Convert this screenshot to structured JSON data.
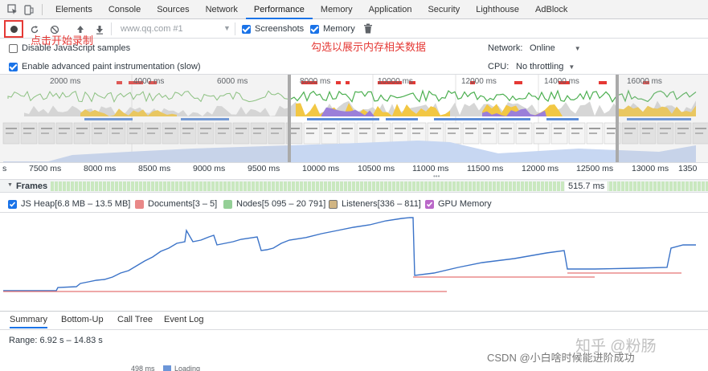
{
  "tabs": [
    "Elements",
    "Console",
    "Sources",
    "Network",
    "Performance",
    "Memory",
    "Application",
    "Security",
    "Lighthouse",
    "AdBlock"
  ],
  "active_tab": "Performance",
  "toolbar": {
    "url_placeholder": "www.qq.com #1",
    "screenshots_label": "Screenshots",
    "memory_label": "Memory",
    "annotation_record": "点击开始录制",
    "annotation_memory": "勾选以展示内存相关数据"
  },
  "settings": {
    "disable_js_samples": "Disable JavaScript samples",
    "advanced_paint": "Enable advanced paint instrumentation (slow)",
    "network_label": "Network:",
    "network_value": "Online",
    "cpu_label": "CPU:",
    "cpu_value": "No throttling"
  },
  "overview_ruler": [
    "2000 ms",
    "4000 ms",
    "6000 ms",
    "8000 ms",
    "10000 ms",
    "12000 ms",
    "14000 ms",
    "16000 ms"
  ],
  "timeline_ruler": [
    "s",
    "7500 ms",
    "8000 ms",
    "8500 ms",
    "9000 ms",
    "9500 ms",
    "10000 ms",
    "10500 ms",
    "11000 ms",
    "11500 ms",
    "12000 ms",
    "12500 ms",
    "13000 ms",
    "1350"
  ],
  "frames": {
    "label": "Frames",
    "value": "515.7 ms"
  },
  "memory_legend": [
    {
      "label": "JS Heap[6.8 MB – 13.5 MB]",
      "color": "#1a73e8",
      "checked": true
    },
    {
      "label": "Documents[3 – 5]",
      "color": "#e57373",
      "checked": false
    },
    {
      "label": "Nodes[5 095 – 20 791]",
      "color": "#81c784",
      "checked": false
    },
    {
      "label": "Listeners[336 – 811]",
      "color": "#c9a96e",
      "checked": false
    },
    {
      "label": "GPU Memory",
      "color": "#ba68c8",
      "checked": true
    }
  ],
  "bottom_tabs": [
    "Summary",
    "Bottom-Up",
    "Call Tree",
    "Event Log"
  ],
  "active_bottom_tab": "Summary",
  "range": "Range: 6.92 s – 14.83 s",
  "partial_row": "498 ms",
  "partial_legend": "Loading",
  "watermarks": {
    "zhihu": "知乎 @粉肠",
    "csdn": "CSDN @小白啥时候能进阶成功"
  }
}
